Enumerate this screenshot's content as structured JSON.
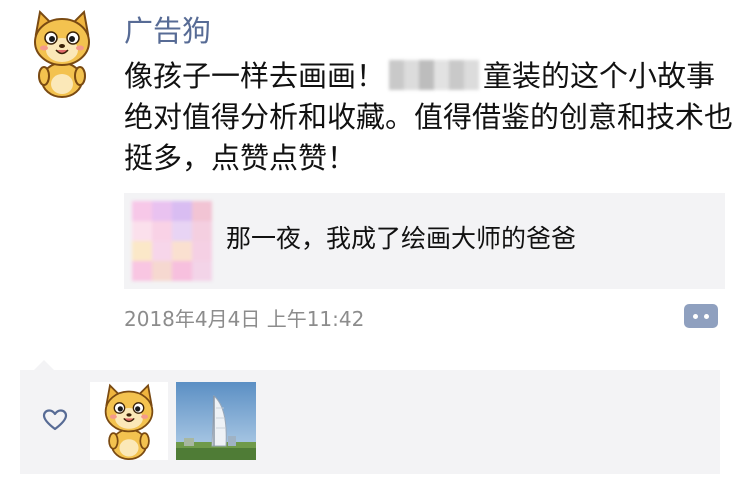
{
  "post": {
    "author": "广告狗",
    "text_before": "像孩子一样去画画！",
    "text_after": "童装的这个小故事绝对值得分析和收藏。值得借鉴的创意和技术也挺多，点赞点赞！",
    "link": {
      "title": "那一夜，我成了绘画大师的爸爸"
    },
    "timestamp": "2018年4月4日 上午11:42"
  },
  "icons": {
    "avatar": "shiba-dog-cartoon-avatar",
    "comment": "comment-dots-icon",
    "like": "heart-outline-icon"
  },
  "colors": {
    "author_name": "#576b95",
    "timestamp": "#8c8c8c",
    "comment_button": "#8fa0bf",
    "panel_bg": "#f3f3f5"
  }
}
